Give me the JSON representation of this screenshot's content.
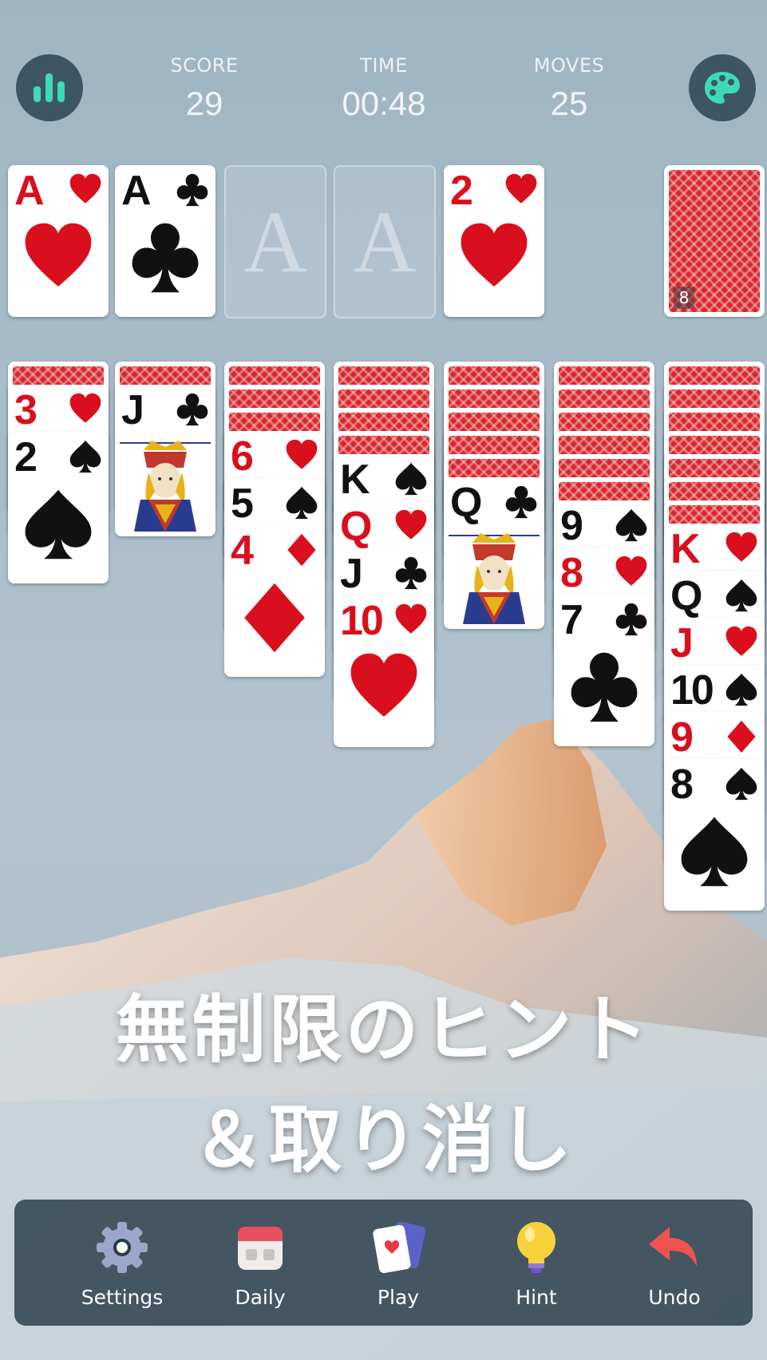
{
  "header": {
    "score_label": "SCORE",
    "score_value": "29",
    "time_label": "TIME",
    "time_value": "00:48",
    "moves_label": "MOVES",
    "moves_value": "25",
    "left_button_icon": "stats-icon",
    "right_button_icon": "palette-icon"
  },
  "foundations": [
    {
      "rank": "A",
      "suit": "hearts"
    },
    {
      "rank": "A",
      "suit": "clubs"
    },
    {
      "placeholder": "A"
    },
    {
      "placeholder": "A"
    }
  ],
  "waste": {
    "rank": "2",
    "suit": "hearts"
  },
  "stock": {
    "count": "8"
  },
  "tableau": [
    {
      "hidden": 1,
      "cards": [
        {
          "rank": "3",
          "suit": "hearts"
        },
        {
          "rank": "2",
          "suit": "spades"
        }
      ]
    },
    {
      "hidden": 1,
      "cards": [
        {
          "rank": "J",
          "suit": "clubs"
        }
      ]
    },
    {
      "hidden": 3,
      "cards": [
        {
          "rank": "6",
          "suit": "hearts"
        },
        {
          "rank": "5",
          "suit": "spades"
        },
        {
          "rank": "4",
          "suit": "diamonds"
        }
      ]
    },
    {
      "hidden": 4,
      "cards": [
        {
          "rank": "K",
          "suit": "spades"
        },
        {
          "rank": "Q",
          "suit": "hearts"
        },
        {
          "rank": "J",
          "suit": "clubs"
        },
        {
          "rank": "10",
          "suit": "hearts"
        }
      ]
    },
    {
      "hidden": 5,
      "cards": [
        {
          "rank": "Q",
          "suit": "clubs"
        }
      ]
    },
    {
      "hidden": 6,
      "cards": [
        {
          "rank": "9",
          "suit": "spades"
        },
        {
          "rank": "8",
          "suit": "hearts"
        },
        {
          "rank": "7",
          "suit": "clubs"
        }
      ]
    },
    {
      "hidden": 7,
      "cards": [
        {
          "rank": "K",
          "suit": "hearts"
        },
        {
          "rank": "Q",
          "suit": "spades"
        },
        {
          "rank": "J",
          "suit": "hearts"
        },
        {
          "rank": "10",
          "suit": "spades"
        },
        {
          "rank": "9",
          "suit": "diamonds"
        },
        {
          "rank": "8",
          "suit": "spades"
        }
      ]
    }
  ],
  "banner": {
    "line1": "無制限のヒント",
    "line2": "＆取り消し"
  },
  "nav": {
    "settings": "Settings",
    "daily": "Daily",
    "play": "Play",
    "hint": "Hint",
    "undo": "Undo"
  },
  "colors": {
    "red_suit": "#d90f1e",
    "black_suit": "#111111",
    "nav_bg": "#263a48",
    "accent_green": "#3dd9b8"
  }
}
